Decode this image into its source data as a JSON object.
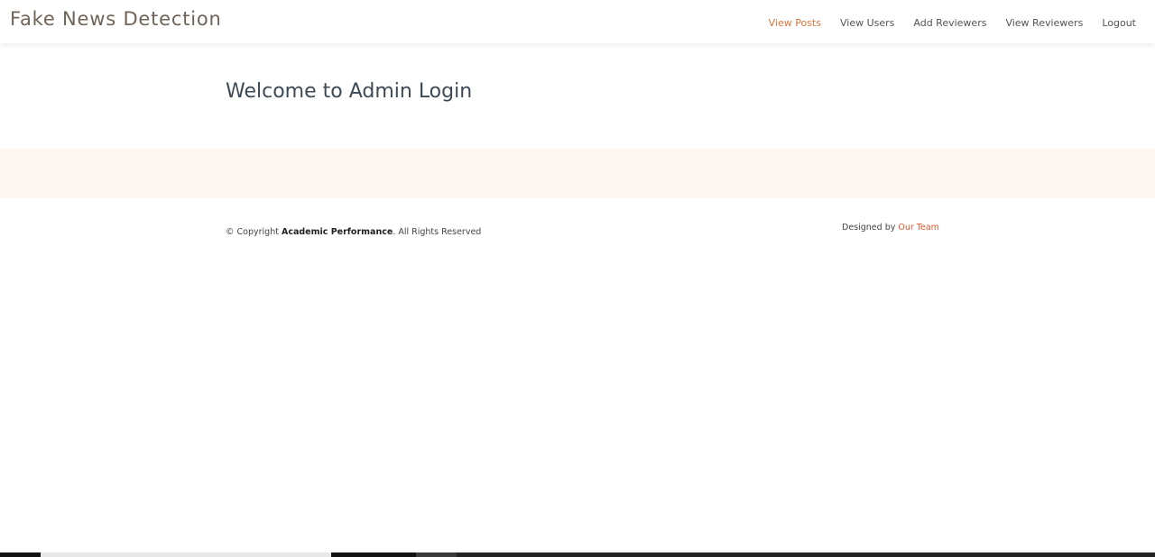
{
  "header": {
    "brand": "Fake News Detection",
    "nav": [
      {
        "label": "View Posts",
        "active": true
      },
      {
        "label": "View Users",
        "active": false
      },
      {
        "label": "Add Reviewers",
        "active": false
      },
      {
        "label": "View Reviewers",
        "active": false
      },
      {
        "label": "Logout",
        "active": false
      }
    ]
  },
  "main": {
    "title": "Welcome to Admin Login"
  },
  "footer": {
    "copyright_prefix": "© Copyright ",
    "copyright_name": "Academic Performance",
    "copyright_suffix": ". All Rights Reserved",
    "designed_by_prefix": "Designed by ",
    "designed_by_link": "Our Team"
  },
  "colors": {
    "accent": "#d9733e",
    "link": "#e0582f",
    "band": "#fdf7f3",
    "brand_text": "#6f6457"
  }
}
